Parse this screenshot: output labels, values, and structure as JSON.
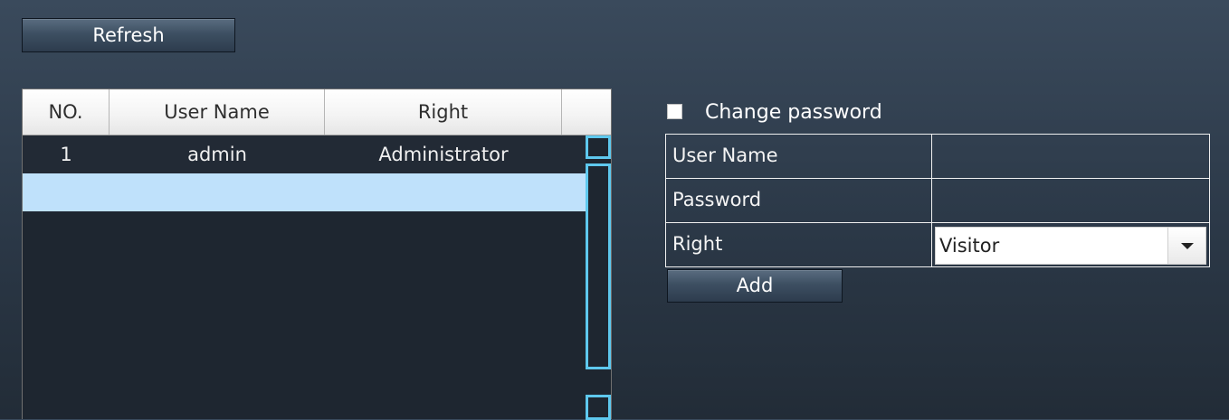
{
  "toolbar": {
    "refresh_label": "Refresh"
  },
  "user_table": {
    "columns": [
      "NO.",
      "User Name",
      "Right",
      ""
    ],
    "rows": [
      {
        "no": "1",
        "user_name": "admin",
        "right": "Administrator"
      }
    ]
  },
  "form": {
    "change_password_label": "Change password",
    "change_password_checked": false,
    "user_name_label": "User Name",
    "user_name_value": "",
    "password_label": "Password",
    "password_value": "",
    "right_label": "Right",
    "right_selected": "Visitor",
    "add_label": "Add"
  },
  "colors": {
    "background_top": "#3a4a5c",
    "background_bottom": "#222c37",
    "selected_row": "#bfe1fb",
    "scrollbar_accent": "#5ec8ee"
  }
}
